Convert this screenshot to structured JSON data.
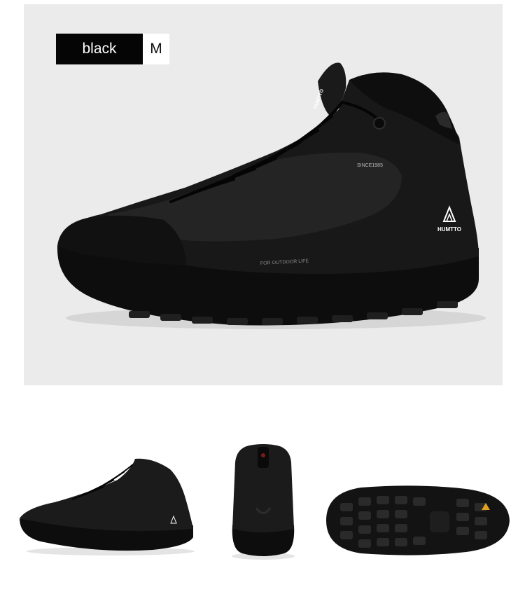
{
  "variant": {
    "color_label": "black",
    "size_label": "M"
  },
  "product_text": {
    "brand": "HUMTTO",
    "tongue_brand": "HUMTTO",
    "since": "SINCE1985",
    "tagline": "FOR OUTDOOR LIFE"
  },
  "colors": {
    "hero_bg": "#ebebeb",
    "shoe": "#161616",
    "accent": "#e0a020"
  },
  "thumbnails": [
    {
      "view": "side-view"
    },
    {
      "view": "back-view"
    },
    {
      "view": "sole-view"
    }
  ]
}
